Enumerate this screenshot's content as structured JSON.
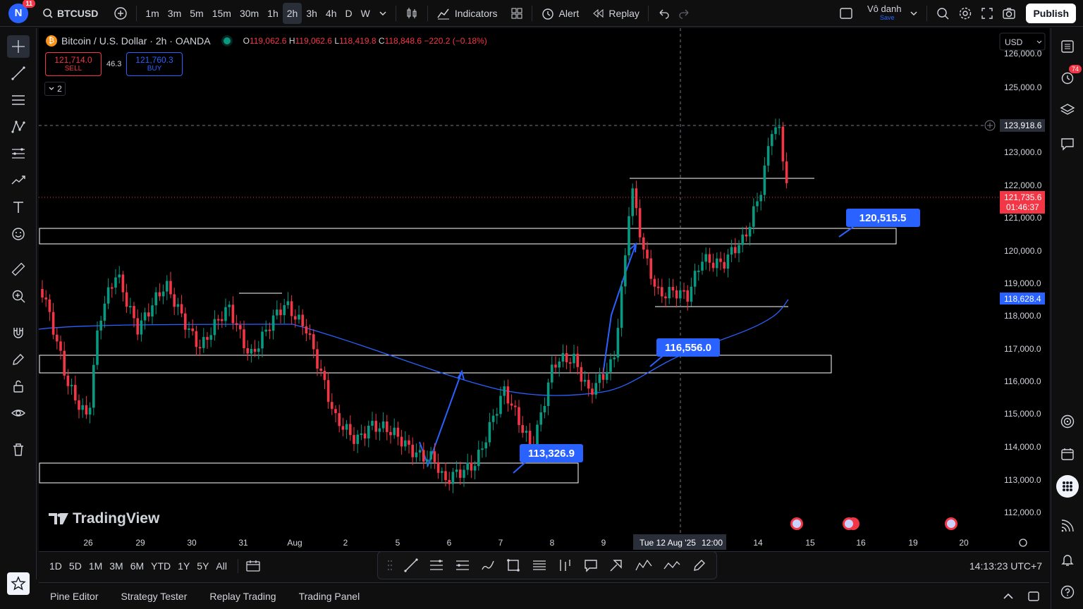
{
  "header": {
    "user_initial": "N",
    "notifications": "11",
    "symbol": "BTCUSD",
    "timeframes": [
      "1m",
      "3m",
      "5m",
      "15m",
      "30m",
      "1h",
      "2h",
      "3h",
      "4h",
      "D",
      "W"
    ],
    "active_timeframe": "2h",
    "indicators_label": "Indicators",
    "alert_label": "Alert",
    "replay_label": "Replay",
    "layout_name": "Vô danh",
    "layout_status": "Save",
    "publish_label": "Publish"
  },
  "legend": {
    "title": "Bitcoin / U.S. Dollar · 2h · OANDA",
    "o_label": "O",
    "o": "119,062.6",
    "h_label": "H",
    "h": "119,062.6",
    "l_label": "L",
    "l": "118,419.8",
    "c_label": "C",
    "c": "118,848.6",
    "change": "−220.2 (−0.18%)",
    "sell_price": "121,714.0",
    "sell_label": "SELL",
    "spread": "46.3",
    "buy_price": "121,760.3",
    "buy_label": "BUY",
    "collapsed_count": "2"
  },
  "price_axis": {
    "currency": "USD",
    "labels": [
      "126,000.0",
      "125,000.0",
      "123,000.0",
      "122,000.0",
      "121,000.0",
      "120,000.0",
      "119,000.0",
      "118,000.0",
      "117,000.0",
      "116,000.0",
      "115,000.0",
      "114,000.0",
      "113,000.0",
      "112,000.0"
    ],
    "crosshair_price": "123,918.6",
    "last_price": "121,735.6",
    "countdown": "01:46:37",
    "ma_price": "118,628.4"
  },
  "time_axis": {
    "labels": [
      "26",
      "29",
      "30",
      "31",
      "Aug",
      "2",
      "5",
      "6",
      "7",
      "8",
      "9",
      "14",
      "15",
      "16",
      "19",
      "20"
    ],
    "crosshair_time": "Tue 12 Aug '25",
    "crosshair_hour": "12:00"
  },
  "annotations": {
    "label_1": "120,515.5",
    "label_2": "116,556.0",
    "label_3": "113,326.9"
  },
  "watermark": "TradingView",
  "bottom": {
    "ranges": [
      "1D",
      "5D",
      "1M",
      "3M",
      "6M",
      "YTD",
      "1Y",
      "5Y",
      "All"
    ],
    "clock": "14:13:23 UTC+7",
    "panels": [
      "Pine Editor",
      "Strategy Tester",
      "Replay Trading",
      "Trading Panel"
    ]
  },
  "alerts_badge": "74",
  "colors": {
    "up": "#089981",
    "down": "#f23645",
    "ma": "#2962ff",
    "label_bg": "#2962ff",
    "background": "#000000"
  }
}
